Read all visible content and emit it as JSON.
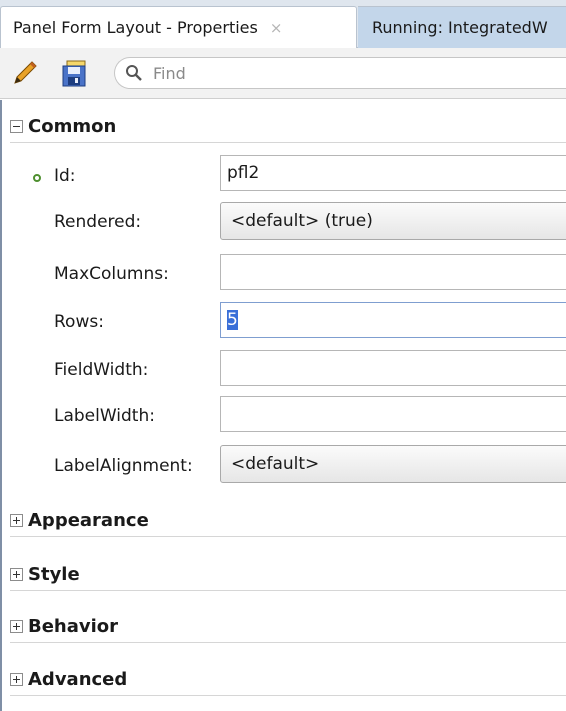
{
  "tabs": [
    {
      "label": "Panel Form Layout - Properties",
      "close": "×",
      "active": true
    },
    {
      "label": "Running: IntegratedW",
      "active": false
    }
  ],
  "toolbar": {
    "edit_icon": "pencil-icon",
    "save_icon": "floppy-disk-icon",
    "search_icon": "search-icon",
    "search_placeholder": "Find"
  },
  "sections": {
    "common": {
      "label": "Common",
      "expanded": true
    },
    "appearance": {
      "label": "Appearance",
      "expanded": false
    },
    "style": {
      "label": "Style",
      "expanded": false
    },
    "behavior": {
      "label": "Behavior",
      "expanded": false
    },
    "advanced": {
      "label": "Advanced",
      "expanded": false
    }
  },
  "properties": {
    "id": {
      "label": "Id:",
      "value": "pfl2",
      "required": true
    },
    "rendered": {
      "label": "Rendered:",
      "value": "<default> (true)"
    },
    "maxcolumns": {
      "label": "MaxColumns:",
      "value": ""
    },
    "rows": {
      "label": "Rows:",
      "value": "5"
    },
    "fieldwidth": {
      "label": "FieldWidth:",
      "value": ""
    },
    "labelwidth": {
      "label": "LabelWidth:",
      "value": ""
    },
    "labelalignment": {
      "label": "LabelAlignment:",
      "value": "<default>"
    }
  },
  "colors": {
    "tabstrip": "#dfe6ee",
    "inactive_tab": "#c3d6ea",
    "required_dot": "#4e8f2f",
    "selection": "#3a6fd8"
  }
}
